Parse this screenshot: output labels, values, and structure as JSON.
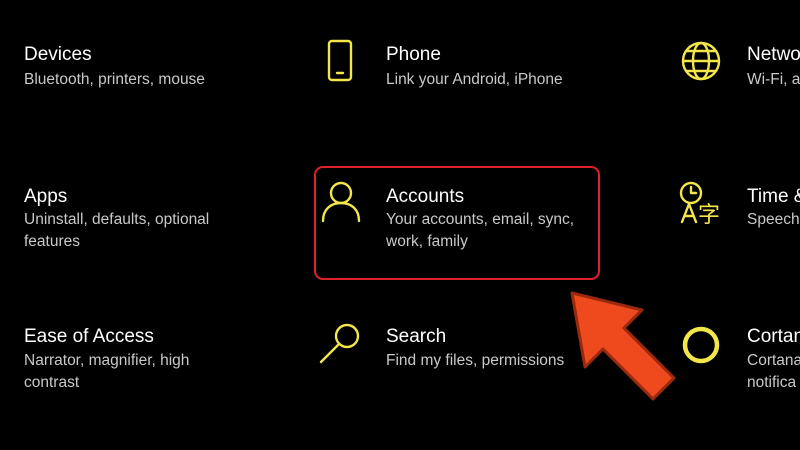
{
  "colors": {
    "background": "#000000",
    "icon_accent": "#f2e64b",
    "highlight": "#e0202b",
    "arrow": "#ee4a1e"
  },
  "tiles": [
    {
      "title": "Devices",
      "desc": "Bluetooth, printers, mouse"
    },
    {
      "title": "Phone",
      "desc": "Link your Android, iPhone",
      "icon": "phone-icon"
    },
    {
      "title": "Netwo",
      "desc": "Wi-Fi, a",
      "icon": "globe-icon"
    },
    {
      "title": "Apps",
      "desc": "Uninstall, defaults, optional features"
    },
    {
      "title": "Accounts",
      "desc": "Your accounts, email, sync, work, family",
      "icon": "person-icon"
    },
    {
      "title": "Time &",
      "desc": "Speech,",
      "icon": "time-language-icon"
    },
    {
      "title": "Ease of Access",
      "desc": "Narrator, magnifier, high contrast"
    },
    {
      "title": "Search",
      "desc": "Find my files, permissions",
      "icon": "search-icon"
    },
    {
      "title": "Cortan",
      "desc": "Cortana notifica",
      "icon": "cortana-icon"
    }
  ],
  "time_icon_glyph": "字"
}
